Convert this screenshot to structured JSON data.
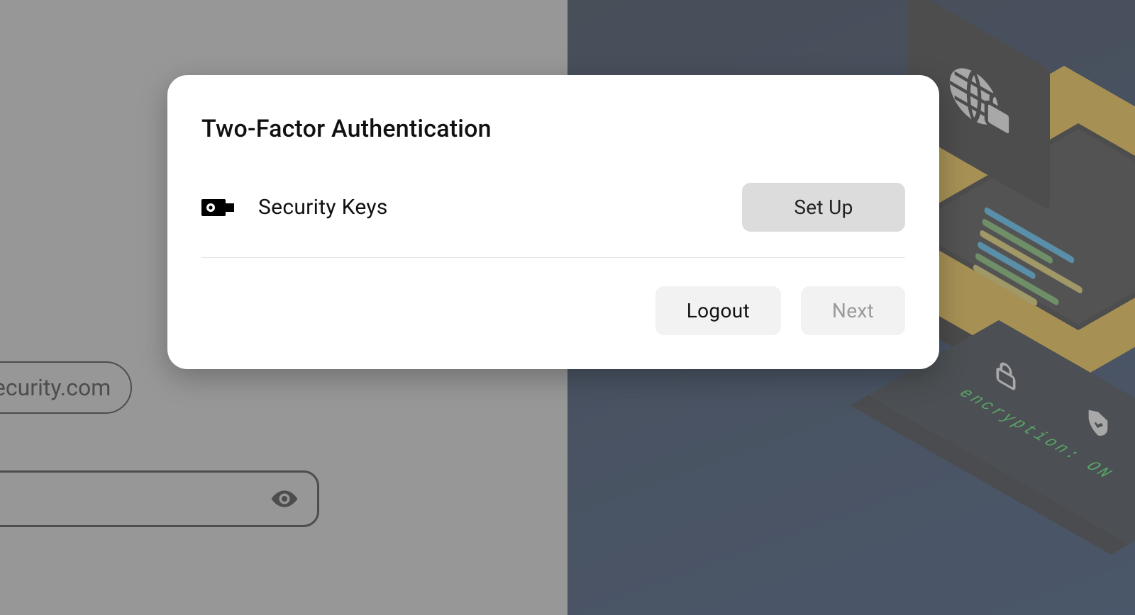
{
  "background": {
    "email_chip": "@keepersecurity.com",
    "encryption_label": "encryption: ON"
  },
  "modal": {
    "title": "Two-Factor Authentication",
    "method": {
      "label": "Security Keys",
      "setup_label": "Set Up"
    },
    "actions": {
      "logout_label": "Logout",
      "next_label": "Next"
    }
  }
}
